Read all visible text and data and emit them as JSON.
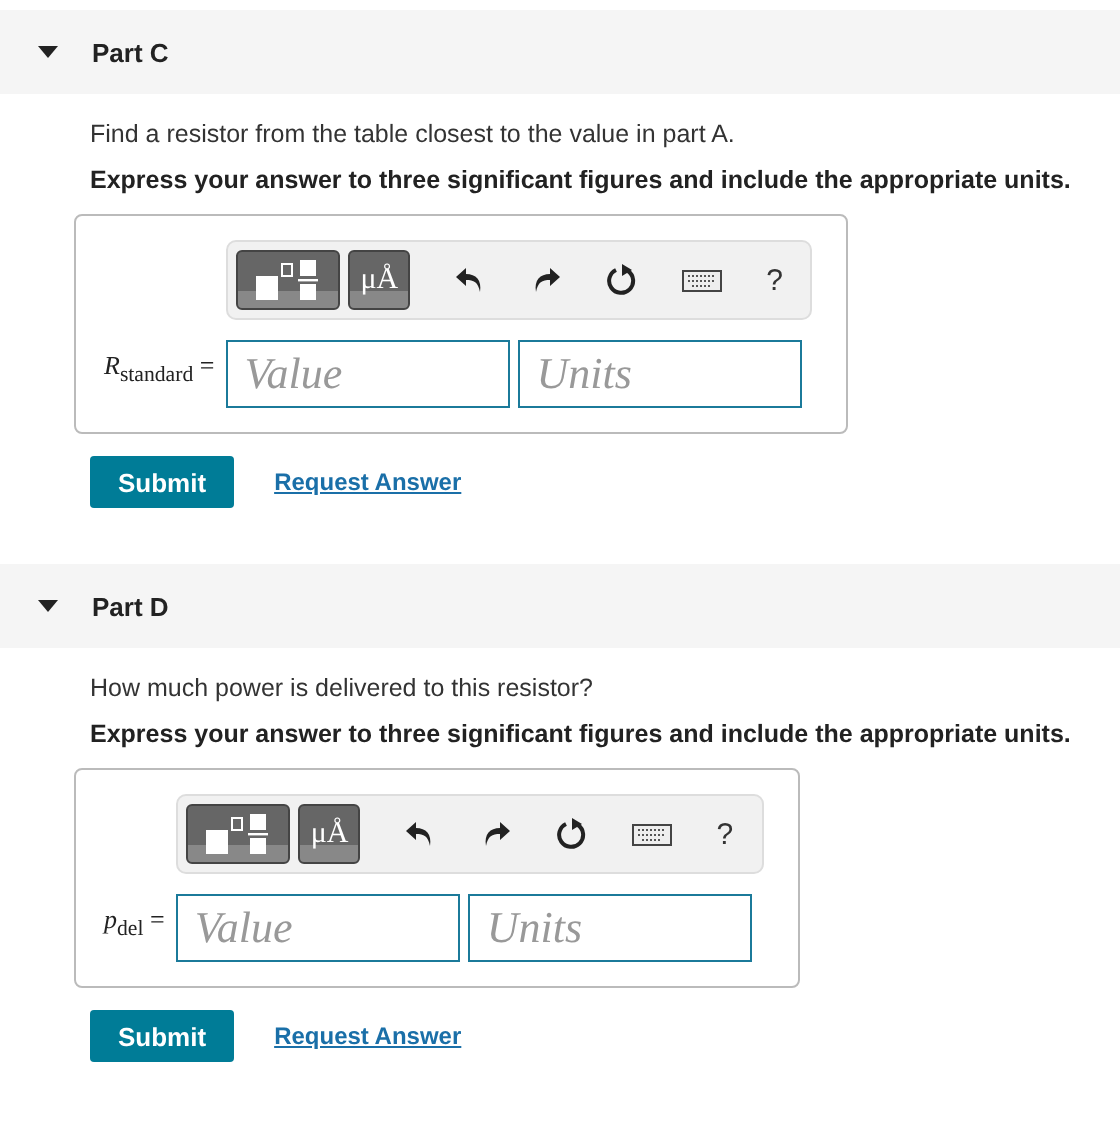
{
  "parts": [
    {
      "title": "Part C",
      "expanded": true,
      "prompt": "Find a resistor from the table closest to the value in part A.",
      "instruction": "Express your answer to three significant figures and include the appropriate units.",
      "units_symbol": "μÅ",
      "help": "?",
      "variable": "*R*$_{standard}$ =",
      "value_placeholder": "Value",
      "units_placeholder": "Units",
      "submit": "Submit",
      "request": "Request Answer"
    },
    {
      "title": "Part D",
      "expanded": true,
      "prompt": "How much power is delivered to this resistor?",
      "instruction": "Express your answer to three significant figures and include the appropriate units.",
      "units_symbol": "μÅ",
      "help": "?",
      "variable": "*p*$_{del}$ =",
      "value_placeholder": "Value",
      "units_placeholder": "Units",
      "submit": "Submit",
      "request": "Request Answer"
    }
  ]
}
